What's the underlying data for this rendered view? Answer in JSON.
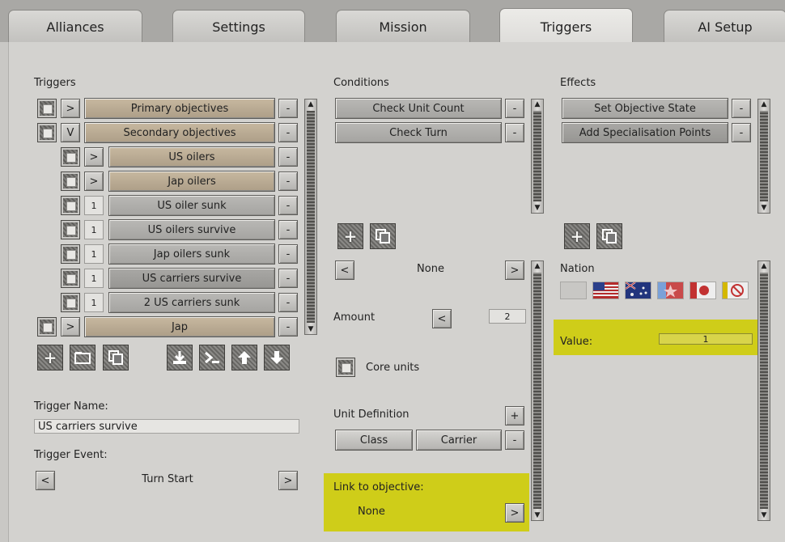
{
  "tabs": [
    "Alliances",
    "Settings",
    "Mission",
    "Triggers",
    "AI Setup"
  ],
  "triggers": {
    "heading": "Triggers",
    "rows": [
      {
        "expander": ">",
        "label": "Primary objectives"
      },
      {
        "expander": "V",
        "label": "Secondary objectives"
      },
      {
        "expander": ">",
        "label": "US oilers"
      },
      {
        "expander": ">",
        "label": "Jap oilers"
      },
      {
        "expander": "1",
        "label": "US oiler sunk"
      },
      {
        "expander": "1",
        "label": "US oilers survive"
      },
      {
        "expander": "1",
        "label": "Jap oilers sunk"
      },
      {
        "expander": "1",
        "label": "US carriers survive"
      },
      {
        "expander": "1",
        "label": "2 US carriers sunk"
      },
      {
        "expander": ">",
        "label": "Jap"
      }
    ],
    "remove_label": "-",
    "toolbar_icons": [
      "add-icon",
      "folder-icon",
      "copy-icon",
      "import-icon",
      "console-icon",
      "move-up-icon",
      "move-down-icon"
    ],
    "name_label": "Trigger Name:",
    "name_value": "US carriers survive",
    "event_label": "Trigger Event:",
    "event_value": "Turn Start",
    "prev": "<",
    "next": ">"
  },
  "conditions": {
    "heading": "Conditions",
    "items": [
      "Check Unit Count",
      "Check Turn"
    ],
    "selector_value": "None",
    "amount_label": "Amount",
    "amount_value": "2",
    "core_units_label": "Core units",
    "unit_def_label": "Unit Definition",
    "plus": "+",
    "minus": "-",
    "class_label": "Class",
    "carrier_label": "Carrier",
    "link_label": "Link to objective:",
    "link_value": "None"
  },
  "effects": {
    "heading": "Effects",
    "items": [
      "Set Objective State",
      "Add Specialisation Points"
    ],
    "nation_label": "Nation",
    "value_label": "Value:",
    "value": "1"
  },
  "colors": {
    "highlight": "#cfcd19",
    "tan": "#bcae96"
  }
}
